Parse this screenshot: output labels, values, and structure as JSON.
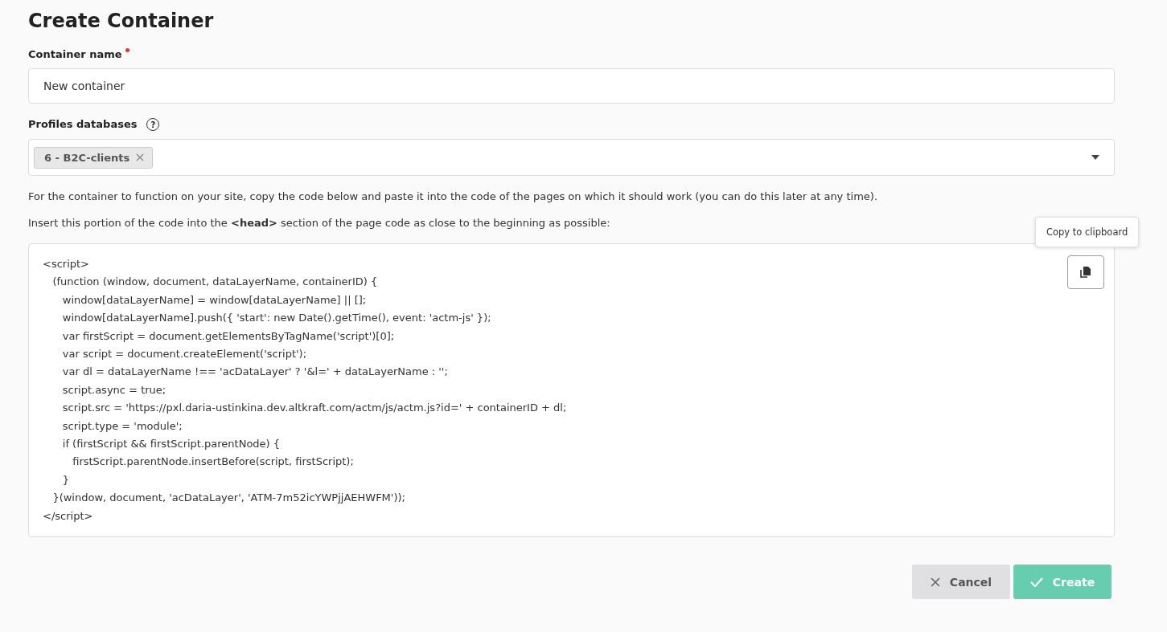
{
  "page": {
    "title": "Create Container"
  },
  "container_name": {
    "label": "Container name",
    "required": true,
    "value": "New container"
  },
  "profiles_databases": {
    "label": "Profiles databases",
    "help_icon": "?",
    "tags": [
      {
        "label": "6 - B2C-clients"
      }
    ]
  },
  "description": "For the container to function on your site, copy the code below and paste it into the code of the pages on which it should work (you can do this later at any time).",
  "instruction": "Insert this portion of the code into the **<head>** section of the page code as close to the beginning as possible:",
  "code": {
    "lines": [
      "<script>",
      "   (function (window, document, dataLayerName, containerID) {",
      "      window[dataLayerName] = window[dataLayerName] || [];",
      "      window[dataLayerName].push({ 'start': new Date().getTime(), event: 'actm-js' });",
      "      var firstScript = document.getElementsByTagName('script')[0];",
      "      var script = document.createElement('script');",
      "      var dl = dataLayerName !== 'acDataLayer' ? '&l=' + dataLayerName : '';",
      "      script.async = true;",
      "      script.src = 'https://pxl.daria-ustinkina.dev.altkraft.com/actm/js/actm.js?id=' + containerID + dl;",
      "      script.type = 'module';",
      "      if (firstScript && firstScript.parentNode) {",
      "         firstScript.parentNode.insertBefore(script, firstScript);",
      "      }",
      "   }(window, document, 'acDataLayer', 'ATM-7m52icYWPjjAEHWFM'));",
      "</script>"
    ],
    "tooltip": "Copy to clipboard"
  },
  "buttons": [
    {
      "kind": "cancel",
      "label": "Cancel",
      "disabled": false
    },
    {
      "kind": "create",
      "label": "Create",
      "disabled": true
    }
  ]
}
